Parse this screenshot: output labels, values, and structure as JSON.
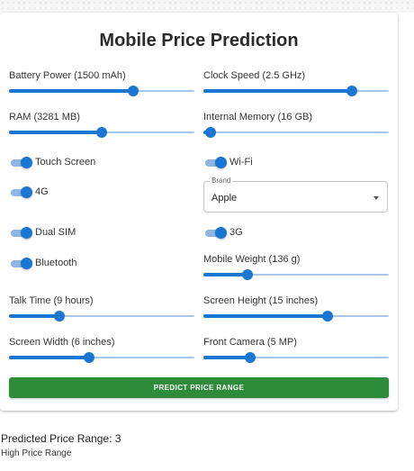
{
  "page": {
    "title": "Mobile Price Prediction"
  },
  "colors": {
    "accent": "#1976d2",
    "track": "#a9c7ef",
    "button": "#2e8b3a"
  },
  "sliders": {
    "battery_power": {
      "label": "Battery Power (1500 mAh)",
      "level": 0.67
    },
    "clock_speed": {
      "label": "Clock Speed (2.5 GHz)",
      "level": 0.8
    },
    "ram": {
      "label": "RAM (3281 MB)",
      "level": 0.5
    },
    "internal_memory": {
      "label": "Internal Memory (16 GB)",
      "level": 0.04
    },
    "mobile_weight": {
      "label": "Mobile Weight (136 g)",
      "level": 0.24
    },
    "talk_time": {
      "label": "Talk Time (9 hours)",
      "level": 0.27
    },
    "screen_height": {
      "label": "Screen Height (15 inches)",
      "level": 0.67
    },
    "screen_width": {
      "label": "Screen Width (6 inches)",
      "level": 0.43
    },
    "front_camera": {
      "label": "Front Camera (5 MP)",
      "level": 0.25
    }
  },
  "toggles": {
    "touch_screen": {
      "label": "Touch Screen",
      "on": true
    },
    "wifi": {
      "label": "Wi-Fi",
      "on": true
    },
    "four_g": {
      "label": "4G",
      "on": true
    },
    "dual_sim": {
      "label": "Dual SIM",
      "on": true
    },
    "three_g": {
      "label": "3G",
      "on": true
    },
    "bluetooth": {
      "label": "Bluetooth",
      "on": true
    }
  },
  "brand": {
    "legend": "Brand",
    "value": "Apple",
    "icon": "chevron-down-icon"
  },
  "predict_button": {
    "label": "PREDICT PRICE RANGE"
  },
  "result": {
    "title": "Predicted Price Range: 3",
    "description": "High Price Range"
  }
}
